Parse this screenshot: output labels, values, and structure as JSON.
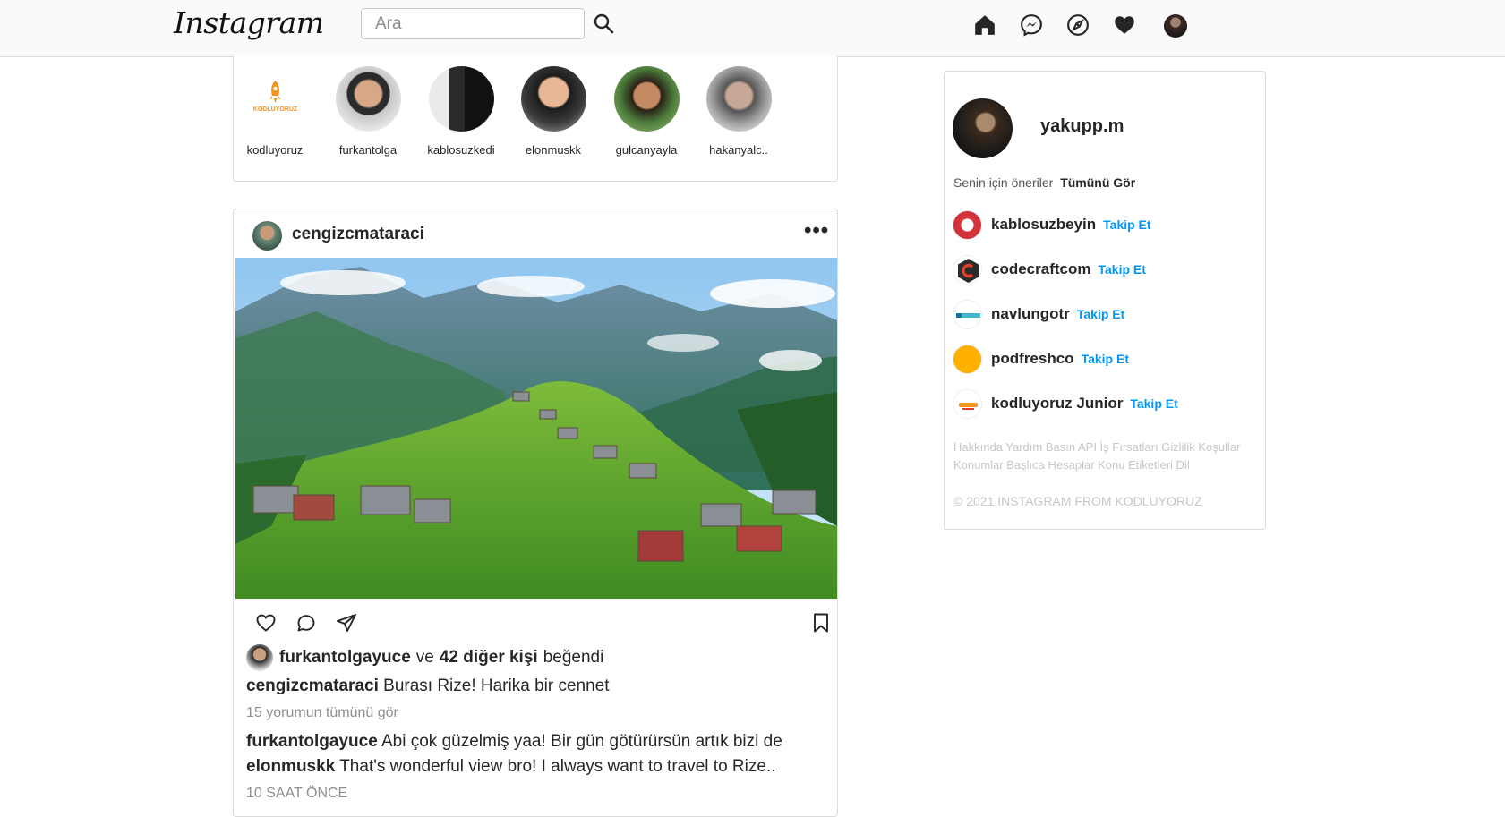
{
  "header": {
    "logo": "Instagram",
    "search_placeholder": "Ara"
  },
  "stories": [
    {
      "username": "kodluyoruz"
    },
    {
      "username": "furkantolga"
    },
    {
      "username": "kablosuzkedi"
    },
    {
      "username": "elonmuskk"
    },
    {
      "username": "gulcanyayla"
    },
    {
      "username": "hakanyalc.."
    }
  ],
  "story_logo_text": "KODLUYORUZ",
  "post": {
    "username": "cengizcmataraci",
    "more": "•••",
    "liked_by": "furkantolgayuce",
    "liked_connector": "ve",
    "liked_others": "42 diğer kişi",
    "liked_suffix": "beğendi",
    "caption_user": "cengizcmataraci",
    "caption_text": "Burası Rize! Harika bir cennet",
    "view_all_comments": "15 yorumun tümünü gör",
    "comments": [
      {
        "user": "furkantolgayuce",
        "text": "Abi çok güzelmiş yaa! Bir gün götürürsün artık bizi de"
      },
      {
        "user": "elonmuskk",
        "text": "That's wonderful view bro! I always want to travel to Rize.."
      }
    ],
    "time": "10 SAAT ÖNCE"
  },
  "sidebar": {
    "username": "yakupp.m",
    "suggestions_label": "Senin için öneriler",
    "see_all": "Tümünü Gör",
    "suggestions": [
      {
        "name": "kablosuzbeyin",
        "follow": "Takip Et"
      },
      {
        "name": "codecraftcom",
        "follow": "Takip Et"
      },
      {
        "name": "navlungotr",
        "follow": "Takip Et"
      },
      {
        "name": "podfreshco",
        "follow": "Takip Et"
      },
      {
        "name": "kodluyoruz Junior",
        "follow": "Takip Et"
      }
    ],
    "footer_links": "Hakkında Yardım Basın API İş Fırsatları Gizlilik Koşullar Konumlar Başlıca Hesaplar Konu Etiketleri Dil",
    "copyright": "© 2021 INSTAGRAM FROM KODLUYORUZ"
  },
  "colors": {
    "accent": "#0095f6",
    "border": "#dbdbdb",
    "muted": "#8e8e8e"
  }
}
